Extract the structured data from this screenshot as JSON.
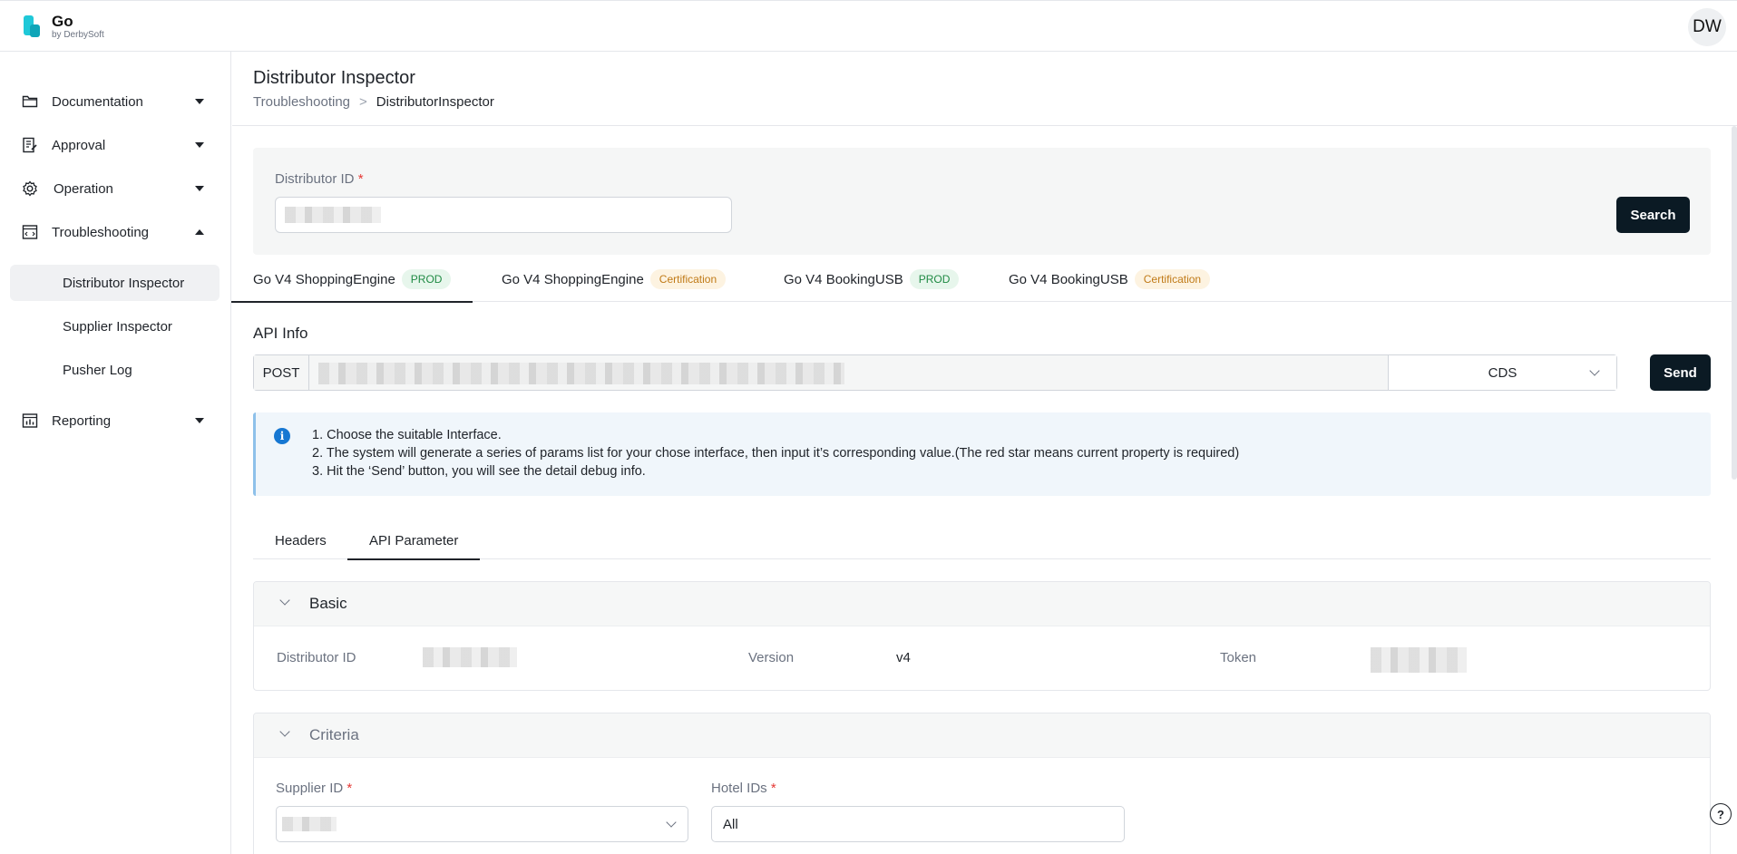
{
  "app": {
    "name": "Go",
    "by": "by DerbySoft",
    "user_initials": "DW"
  },
  "sidebar": {
    "items": [
      {
        "label": "Documentation",
        "icon": "folder-icon"
      },
      {
        "label": "Approval",
        "icon": "edit-document-icon"
      },
      {
        "label": "Operation",
        "icon": "gear-icon"
      },
      {
        "label": "Troubleshooting",
        "icon": "code-window-icon"
      },
      {
        "label": "Reporting",
        "icon": "bar-chart-icon"
      }
    ],
    "sub_items": [
      "Distributor Inspector",
      "Supplier Inspector",
      "Pusher Log"
    ]
  },
  "header": {
    "title": "Distributor Inspector",
    "breadcrumb": {
      "parent": "Troubleshooting",
      "separator": ">",
      "current": "DistributorInspector"
    }
  },
  "search": {
    "label": "Distributor ID",
    "required_mark": "*",
    "button": "Search"
  },
  "tabs": [
    {
      "label": "Go V4 ShoppingEngine",
      "badge": "PROD"
    },
    {
      "label": "Go V4 ShoppingEngine",
      "badge": "Certification"
    },
    {
      "label": "Go V4 BookingUSB",
      "badge": "PROD"
    },
    {
      "label": "Go V4 BookingUSB",
      "badge": "Certification"
    }
  ],
  "api": {
    "section_title": "API Info",
    "method": "POST",
    "env": "CDS",
    "send_button": "Send"
  },
  "info": {
    "lines": [
      "1. Choose the suitable Interface.",
      "2. The system will generate a series of params list for your chose interface, then input it’s corresponding value.(The red star means current property is required)",
      "3. Hit the ‘Send’ button, you will see the detail debug info."
    ]
  },
  "subtabs": [
    "Headers",
    "API Parameter"
  ],
  "basic": {
    "title": "Basic",
    "fields": {
      "distributor_label": "Distributor ID",
      "version_label": "Version",
      "version_value": "v4",
      "token_label": "Token"
    }
  },
  "criteria": {
    "title": "Criteria",
    "supplier_label": "Supplier ID",
    "hotel_label": "Hotel IDs",
    "hotel_value": "All"
  },
  "colors": {
    "accent_dark": "#0b1a24",
    "prod_badge": "#1f8a43",
    "cert_badge": "#c07a17",
    "info_blue": "#1677d2",
    "required": "#e53935"
  }
}
